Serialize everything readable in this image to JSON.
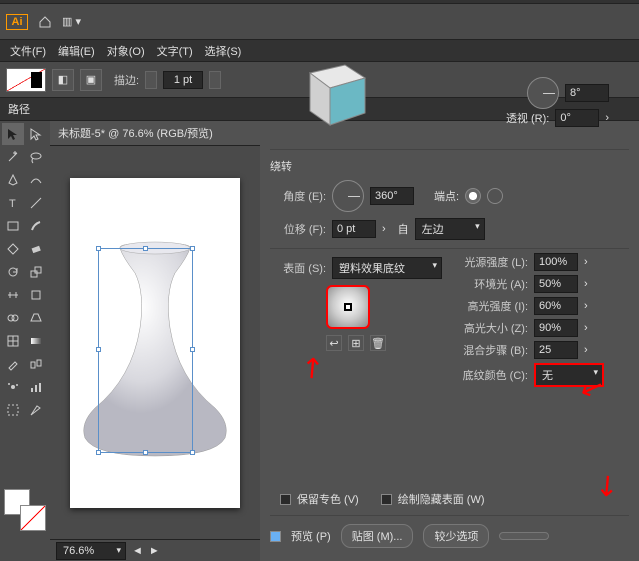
{
  "app": {
    "brand": "Ai"
  },
  "menu": {
    "file": "文件(F)",
    "edit": "编辑(E)",
    "object": "对象(O)",
    "type": "文字(T)",
    "select": "选择(S)"
  },
  "topbar": {
    "strokeLabel": "描边:",
    "strokeVal": "1 pt"
  },
  "props": {
    "pathLabel": "路径"
  },
  "doc": {
    "title": "未标题-5* @ 76.6% (RGB/预览)"
  },
  "zoom": {
    "val": "76.6%"
  },
  "panel": {
    "rotate": "绕转",
    "angleL": "角度 (E):",
    "angleV": "360°",
    "endcapL": "端点:",
    "posL": "位移 (F):",
    "posV": "0 pt",
    "fromL": "自",
    "fromV": "左边",
    "surfL": "表面 (S):",
    "surfV": "塑料效果底纹",
    "lightIntL": "光源强度 (L):",
    "lightIntV": "100%",
    "ambientL": "环境光 (A):",
    "ambientV": "50%",
    "highlightIntL": "高光强度 (I):",
    "highlightV": "60%",
    "highlightSizeL": "高光大小 (Z):",
    "highlightSizeV": "90%",
    "blendL": "混合步骤 (B):",
    "blendV": "25",
    "shadeColorL": "底纹颜色 (C):",
    "shadeColorV": "无",
    "preserveSpotL": "保留专色 (V)",
    "drawHiddenL": "绘制隐藏表面 (W)",
    "previewL": "预览 (P)",
    "mapArtL": "贴图 (M)...",
    "fewerL": "较少选项",
    "perspectiveL": "透视 (R):",
    "perspectiveV": "0°",
    "tiltV": "8°"
  }
}
